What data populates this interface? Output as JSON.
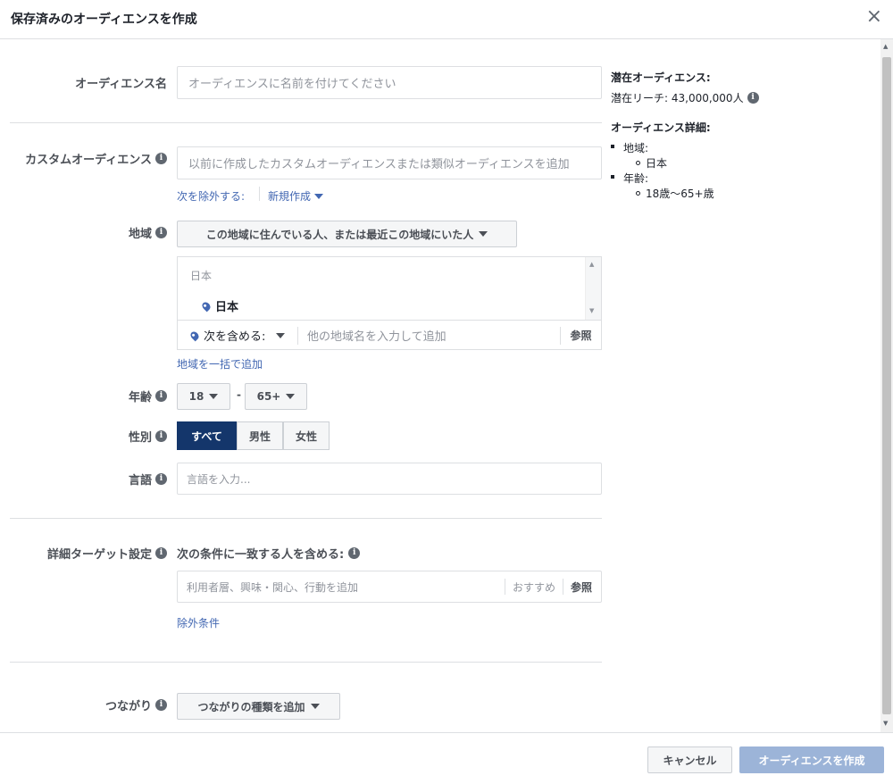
{
  "header": {
    "title": "保存済みのオーディエンスを作成",
    "close": "×"
  },
  "audience_name": {
    "label": "オーディエンス名",
    "placeholder": "オーディエンスに名前を付けてください"
  },
  "custom_audience": {
    "label": "カスタムオーディエンス",
    "placeholder": "以前に作成したカスタムオーディエンスまたは類似オーディエンスを追加",
    "exclude_link": "次を除外する:",
    "create_new_link": "新規作成"
  },
  "location": {
    "label": "地域",
    "dropdown": "この地域に住んでいる人、または最近この地域にいた人",
    "list_header": "日本",
    "selected_item": "日本",
    "include_label": "次を含める:",
    "search_placeholder": "他の地域名を入力して追加",
    "browse": "参照",
    "bulk_link": "地域を一括で追加"
  },
  "age": {
    "label": "年齢",
    "min": "18",
    "sep": "-",
    "max": "65+"
  },
  "gender": {
    "label": "性別",
    "options": [
      "すべて",
      "男性",
      "女性"
    ]
  },
  "language": {
    "label": "言語",
    "placeholder": "言語を入力..."
  },
  "detailed_targeting": {
    "label": "詳細ターゲット設定",
    "condition": "次の条件に一致する人を含める:",
    "placeholder": "利用者層、興味・関心、行動を追加",
    "suggestions": "おすすめ",
    "browse": "参照",
    "exclude_link": "除外条件"
  },
  "connections": {
    "label": "つながり",
    "dropdown": "つながりの種類を追加"
  },
  "sidebar": {
    "potential_title": "潜在オーディエンス:",
    "reach": "潜在リーチ: 43,000,000人",
    "details_title": "オーディエンス詳細:",
    "location_label": "地域:",
    "location_value": "日本",
    "age_label": "年齢:",
    "age_value": "18歳～65+歳"
  },
  "footer": {
    "cancel": "キャンセル",
    "create": "オーディエンスを作成"
  },
  "colors": {
    "accent": "#4267b2",
    "selected": "#14366b",
    "create_disabled": "#9cb4d8"
  }
}
